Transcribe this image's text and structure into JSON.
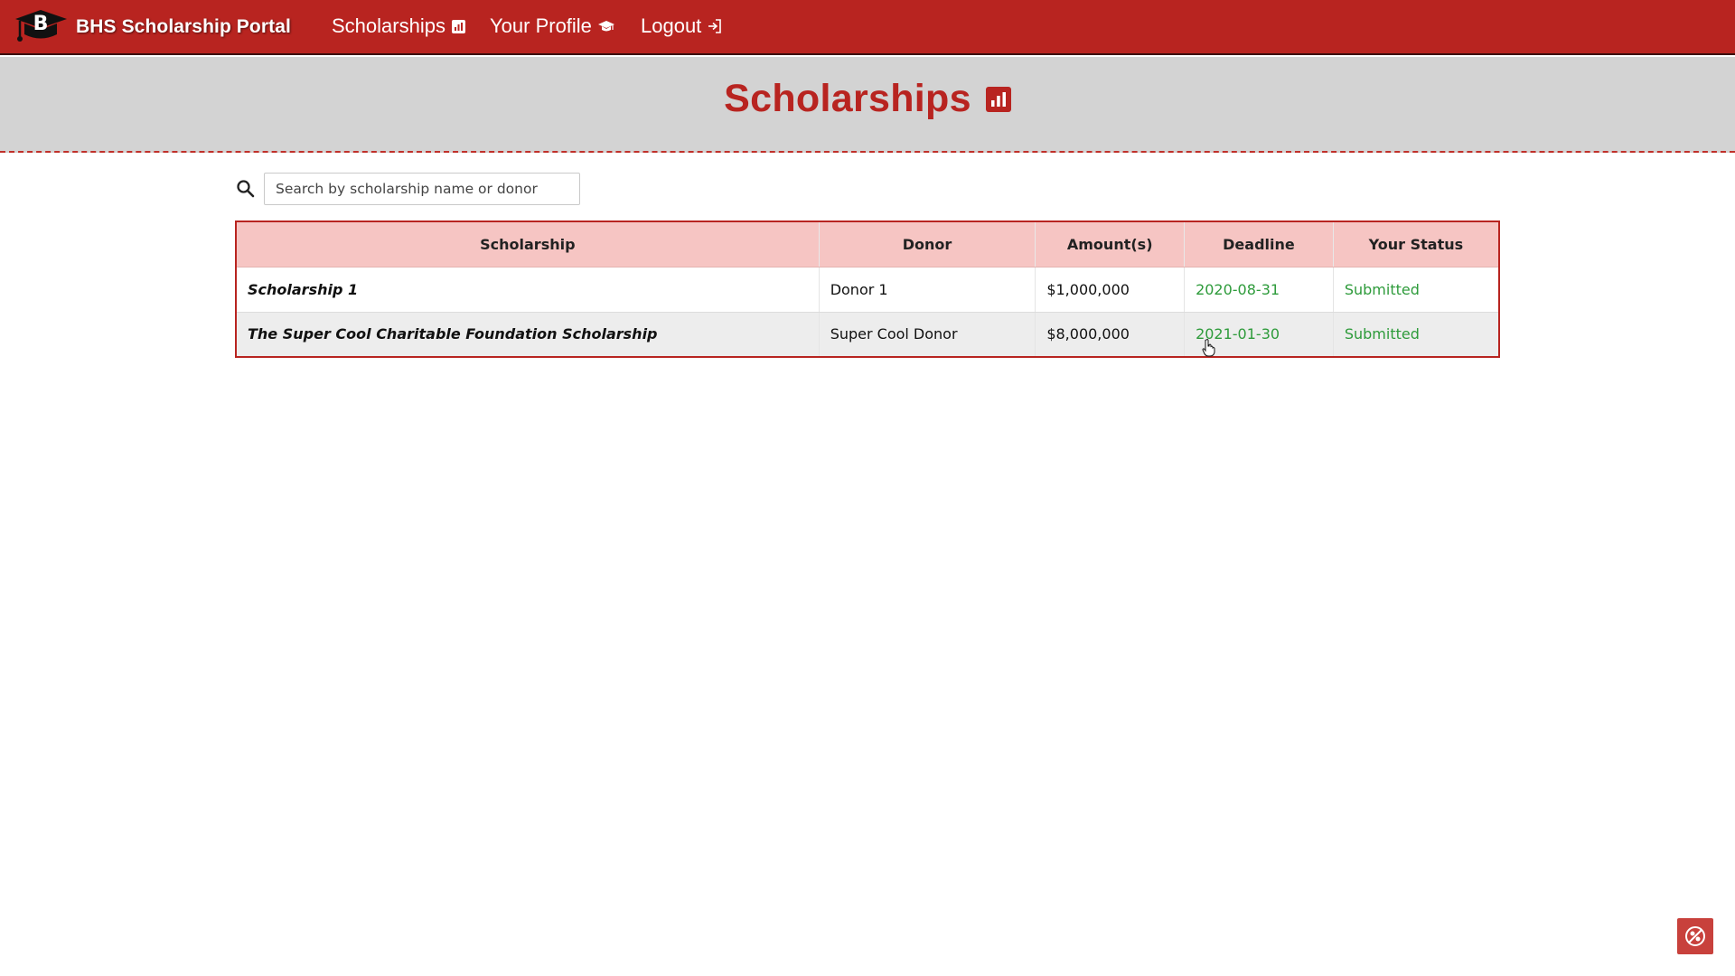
{
  "navbar": {
    "brand": {
      "logo_letter": "B",
      "title": "BHS Scholarship Portal",
      "icon": "graduation-cap-logo"
    },
    "links": [
      {
        "label": "Scholarships",
        "icon": "bar-chart-icon"
      },
      {
        "label": "Your Profile",
        "icon": "graduation-cap-icon"
      },
      {
        "label": "Logout",
        "icon": "sign-out-icon"
      }
    ]
  },
  "header": {
    "title": "Scholarships",
    "icon": "bar-chart-icon"
  },
  "search": {
    "placeholder": "Search by scholarship name or donor",
    "value": ""
  },
  "table": {
    "columns": [
      "Scholarship",
      "Donor",
      "Amount(s)",
      "Deadline",
      "Your Status"
    ],
    "rows": [
      {
        "scholarship": "Scholarship 1",
        "donor": "Donor 1",
        "amount": "$1,000,000",
        "deadline": "2020-08-31",
        "status": "Submitted"
      },
      {
        "scholarship": "The Super Cool Charitable Foundation Scholarship",
        "donor": "Super Cool Donor",
        "amount": "$8,000,000",
        "deadline": "2021-01-30",
        "status": "Submitted"
      }
    ]
  },
  "colors": {
    "brand_red": "#b82420",
    "header_gray": "#d3d3d3",
    "table_header_pink": "#f6c5c3",
    "status_green": "#2e9b3b"
  }
}
